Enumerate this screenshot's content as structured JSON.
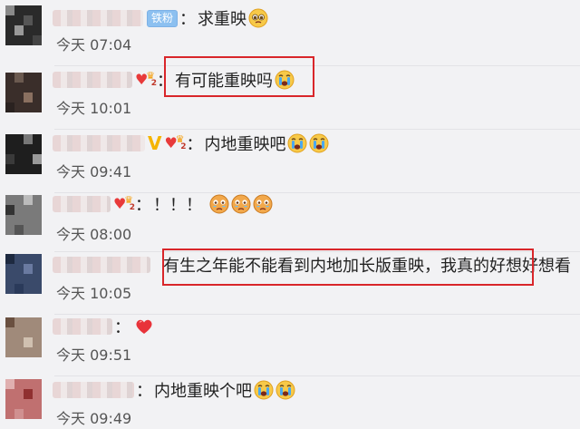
{
  "comments": [
    {
      "badge": "铁粉",
      "colon": "：",
      "text": "求重映",
      "time": "今天 07:04"
    },
    {
      "colon": "：",
      "text": "有可能重映吗",
      "time": "今天 10:01"
    },
    {
      "vip": "V",
      "colon": "：",
      "text": "内地重映吧",
      "time": "今天 09:41"
    },
    {
      "colon": "：",
      "text": "！！！",
      "time": "今天 08:00"
    },
    {
      "colon": "",
      "text": "有生之年能不能看到内地加长版重映，我真的好想好想看",
      "time": "今天 10:05"
    },
    {
      "colon": "：",
      "text": "",
      "time": "今天 09:51"
    },
    {
      "colon": "：",
      "text": "内地重映个吧",
      "time": "今天 09:49"
    }
  ],
  "fan_badge_number": "2",
  "colors": {
    "highlight_border": "#d9262a",
    "fan_badge": "#8cc0f0",
    "vip": "#f5b400",
    "heart": "#e83a3a"
  },
  "icons": [
    "crying-emoji-icon",
    "pleading-emoji-icon",
    "tearing-up-emoji-icon",
    "red-heart-icon",
    "v-badge-icon",
    "fan-heart-badge-icon"
  ]
}
